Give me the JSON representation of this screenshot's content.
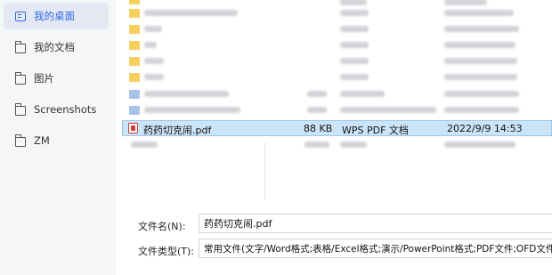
{
  "sidebar": {
    "items": [
      {
        "label": "我的桌面",
        "icon": "desktop-icon",
        "active": true
      },
      {
        "label": "我的文档",
        "icon": "folder-icon",
        "active": false
      },
      {
        "label": "图片",
        "icon": "folder-icon",
        "active": false
      },
      {
        "label": "Screenshots",
        "icon": "folder-icon",
        "active": false
      },
      {
        "label": "ZM",
        "icon": "folder-icon",
        "active": false
      }
    ]
  },
  "file_list": {
    "selected_row": {
      "name": "药药切克闹.pdf",
      "size": "88 KB",
      "type": "WPS PDF 文档",
      "modified": "2022/9/9 14:53",
      "icon": "pdf-icon"
    }
  },
  "footer": {
    "filename_label": "文件名(N):",
    "filename_value": "药药切克闹.pdf",
    "filetype_label": "文件类型(T):",
    "filetype_value": "常用文件(文字/Word格式;表格/Excel格式;演示/PowerPoint格式;PDF文件;OFD文件)"
  },
  "colors": {
    "accent": "#2f6ae6",
    "selected_row_bg": "#cce4f7",
    "sidebar_bg": "#f5f6f8"
  }
}
